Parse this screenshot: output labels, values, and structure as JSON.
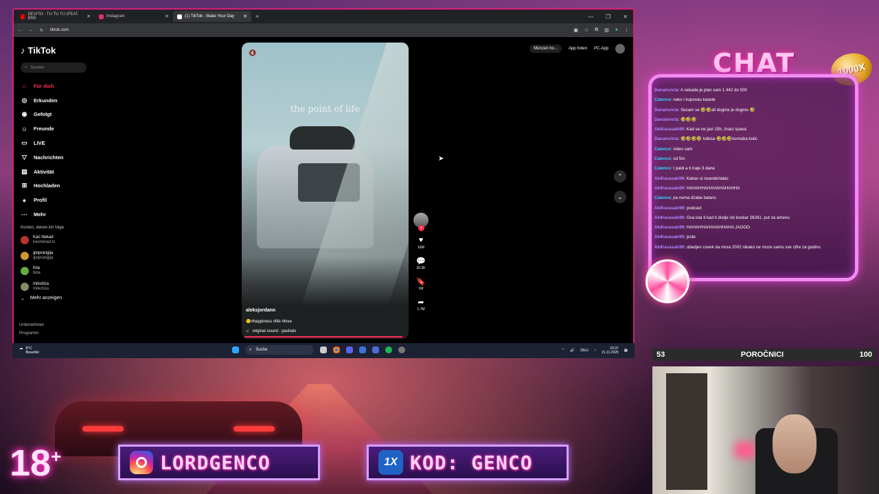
{
  "browser": {
    "tabs": [
      {
        "label": "DEVITO - TU TU TU (FEAT. BRE",
        "fav_color": "#ff0000"
      },
      {
        "label": "Instagram",
        "fav_color": "#e1306c"
      },
      {
        "label": "(1) TikTok - Make Your Day",
        "fav_color": "#ffffff"
      }
    ],
    "url": "tiktok.com"
  },
  "tiktok": {
    "logo": "TikTok",
    "search_placeholder": "Suchen",
    "nav": [
      {
        "label": "Für dich",
        "icon": "home-icon",
        "glyph": "⌂"
      },
      {
        "label": "Erkunden",
        "icon": "compass-icon",
        "glyph": "◎"
      },
      {
        "label": "Gefolgt",
        "icon": "following-icon",
        "glyph": "◉"
      },
      {
        "label": "Freunde",
        "icon": "friends-icon",
        "glyph": "☺"
      },
      {
        "label": "LIVE",
        "icon": "live-icon",
        "glyph": "▭"
      },
      {
        "label": "Nachrichten",
        "icon": "messages-icon",
        "glyph": "▽"
      },
      {
        "label": "Aktivität",
        "icon": "activity-icon",
        "glyph": "▤"
      },
      {
        "label": "Hochladen",
        "icon": "upload-icon",
        "glyph": "⊞"
      },
      {
        "label": "Profil",
        "icon": "profile-icon",
        "glyph": "●"
      },
      {
        "label": "Mehr",
        "icon": "more-icon",
        "glyph": "···"
      }
    ],
    "following_title": "Konten, denen ich folge",
    "following": [
      {
        "name": "Kao Nekad",
        "handle": "kaonekad.tv"
      },
      {
        "name": "gioprangija",
        "handle": "gioprangija"
      },
      {
        "name": "Kila",
        "handle": "tkila"
      },
      {
        "name": "milozliza",
        "handle": "milezliza"
      }
    ],
    "show_more": "Mehr anzeigen",
    "footer": [
      "Unternehmen",
      "Programm"
    ],
    "topright": {
      "coins": "Münzen ho...",
      "app": "App holen",
      "pc": "PC-App"
    },
    "video": {
      "overlay_text": "the point of life",
      "author": "aleksjordann",
      "tags": "🙂#happiness #life #love",
      "sound": "original sound - pashatv",
      "progress": 0.98
    },
    "actions": {
      "likes": "16M",
      "comments": "20.2K",
      "saves": "1M",
      "shares": "1.7M"
    }
  },
  "taskbar": {
    "weather_temp": "8°C",
    "weather_desc": "Bewölkt",
    "search": "Suche",
    "lang": "DEU",
    "time": "23:37",
    "date": "21.11.2025"
  },
  "chat": {
    "title": "CHAT",
    "badge": "1000X",
    "messages": [
      {
        "user": "Danainvicta",
        "text": ": A nekada je plan sam 1 442 do 500",
        "color": "#b088ff"
      },
      {
        "user": "Calence",
        "text": ": neko i kupovao kasete",
        "color": "#2fd6ff"
      },
      {
        "user": "Danainvicta",
        "text": ": Secam se 🤣🤣all dugme je dugme 🤣",
        "color": "#b088ff"
      },
      {
        "user": "Danainvicta",
        "text": ": 🤣🤣🤣",
        "color": "#b088ff"
      },
      {
        "user": "AkiKavasaki99",
        "text": ": Kad se ne javi 15h, znaci spava",
        "color": "#b088ff"
      },
      {
        "user": "Danainvicta",
        "text": ": 🤣🤣🤣🤣 lutkica 🤣🤣🤣komsika kulic",
        "color": "#b088ff"
      },
      {
        "user": "Calence",
        "text": ": video sam",
        "color": "#2fd6ff"
      },
      {
        "user": "Calence",
        "text": ": od 5m",
        "color": "#2fd6ff"
      },
      {
        "user": "Calence",
        "text": ": I pakli a ti traje 3 dana",
        "color": "#2fd6ff"
      },
      {
        "user": "AkiKavasaki99",
        "text": ": Kakav si neandertalac",
        "color": "#b088ff"
      },
      {
        "user": "AkiKavasaki99",
        "text": ": HAHAHHAHAHAHAHAHHA",
        "color": "#b088ff"
      },
      {
        "user": "Calence",
        "text": ": pa nema dzabe balans",
        "color": "#2fd6ff"
      },
      {
        "user": "AkiKavasaki99",
        "text": ": podcast",
        "color": "#b088ff"
      },
      {
        "user": "AkiKavasaki99",
        "text": ": Ova ista ti kad ti dodje isti kockar 28261. put za amenu",
        "color": "#b088ff"
      },
      {
        "user": "AkiKavasaki99",
        "text": ": HAHAHHAHAHAHHAHA JAOOO",
        "color": "#b088ff"
      },
      {
        "user": "AkiKavasaki99",
        "text": ": jeste",
        "color": "#b088ff"
      },
      {
        "user": "AkiKavasaki99",
        "text": ": ubedjen covek da mora 2002 nikako ne moze samo sve cifre za godinu",
        "color": "#b088ff"
      }
    ]
  },
  "newsbar": {
    "left": "53",
    "title": "POROČNICI",
    "right": "100"
  },
  "overlay": {
    "age": "18",
    "age_plus": "+",
    "instagram": "LORDGENCO",
    "promo": "KOD: GENCO",
    "promo_logo": "1X"
  }
}
